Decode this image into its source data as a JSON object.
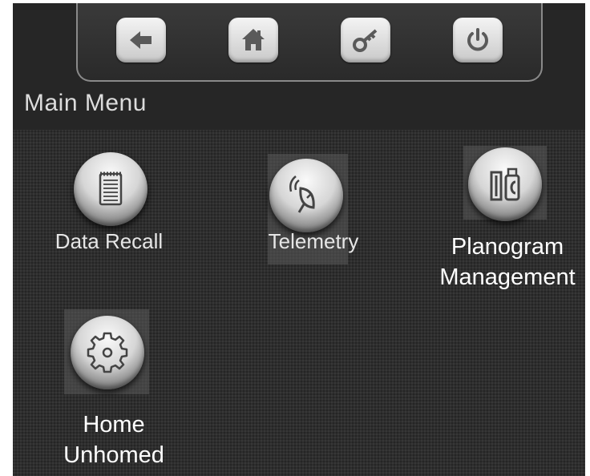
{
  "toolbar": {
    "buttons": [
      {
        "name": "back-button",
        "icon": "arrow-left-icon"
      },
      {
        "name": "home-button",
        "icon": "house-icon"
      },
      {
        "name": "key-button",
        "icon": "key-icon"
      },
      {
        "name": "power-button",
        "icon": "power-icon"
      }
    ]
  },
  "title": "Main Menu",
  "menu": {
    "data_recall": {
      "label": "Data Recall",
      "icon": "notepad-icon"
    },
    "telemetry": {
      "label": "Telemetry",
      "icon": "satellite-dish-icon"
    },
    "planogram": {
      "line1": "Planogram",
      "line2": "Management",
      "icon": "products-icon"
    },
    "home": {
      "line1": "Home",
      "line2": "Unhomed",
      "icon": "gear-icon"
    }
  }
}
